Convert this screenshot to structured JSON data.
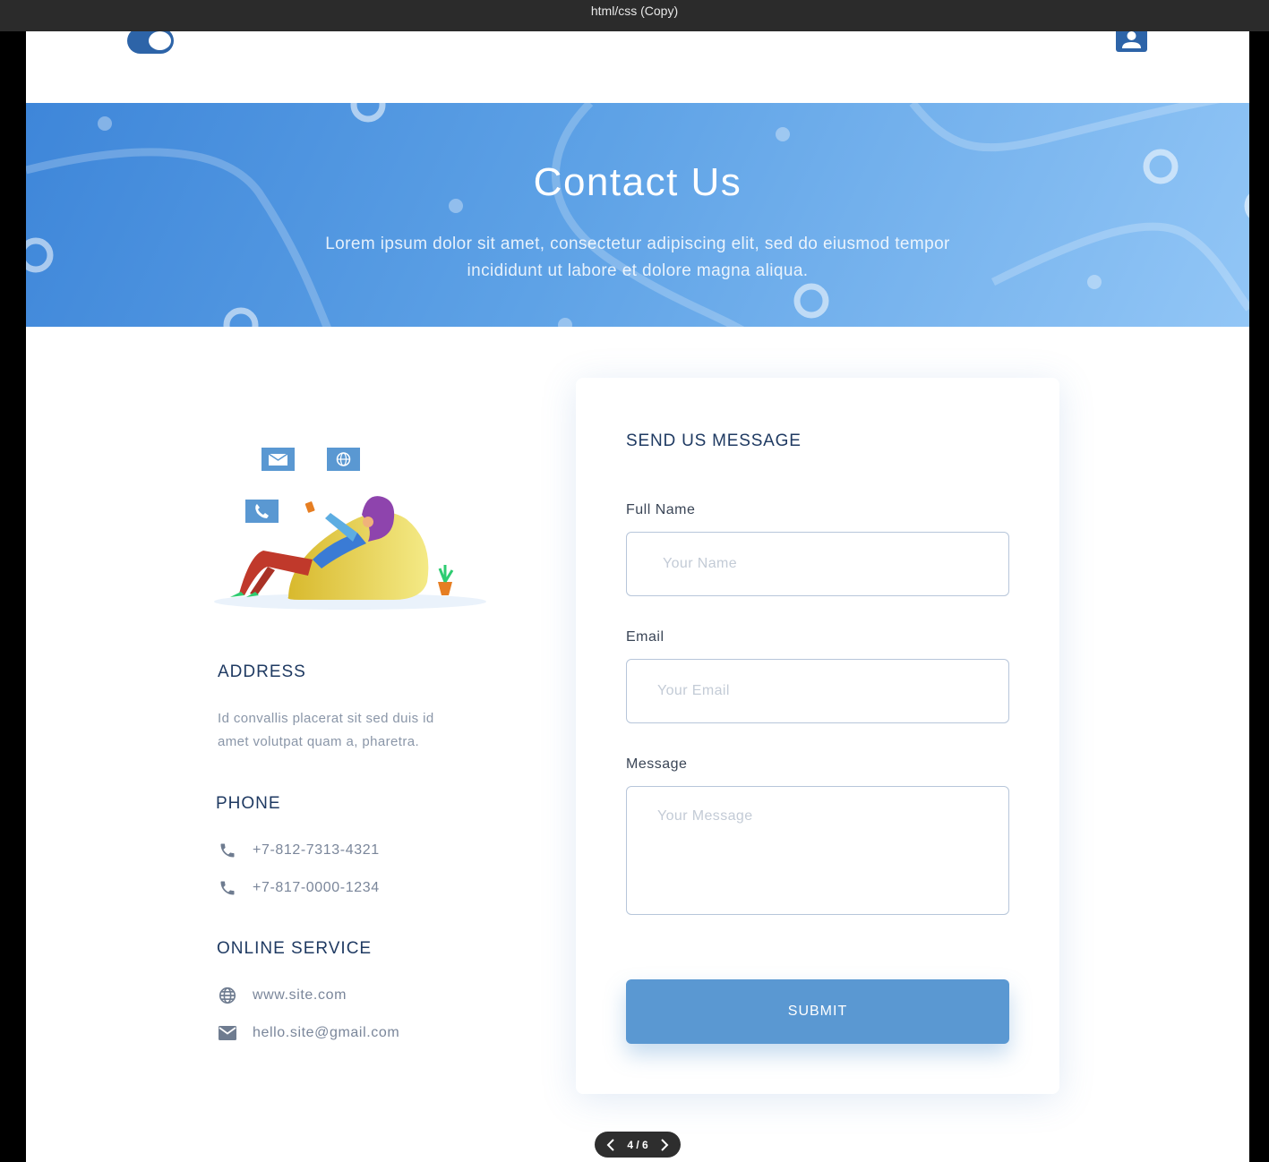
{
  "window": {
    "title": "html/css (Copy)"
  },
  "nav": {
    "toggle_icon": "toggle-icon",
    "user_icon": "user-icon"
  },
  "hero": {
    "title": "Contact Us",
    "subtitle_line1": "Lorem ipsum dolor sit amet, consectetur adipiscing elit, sed do eiusmod tempor",
    "subtitle_line2": "incididunt ut labore et dolore magna aliqua."
  },
  "info": {
    "address": {
      "heading": "ADDRESS",
      "line1": "Id convallis placerat sit sed duis id",
      "line2": "amet volutpat quam a, pharetra."
    },
    "phone": {
      "heading": "PHONE",
      "numbers": [
        "+7-812-7313-4321",
        "+7-817-0000-1234"
      ]
    },
    "online": {
      "heading": "ONLINE SERVICE",
      "website": "www.site.com",
      "email": "hello.site@gmail.com"
    }
  },
  "form": {
    "title": "SEND US MESSAGE",
    "name_label": "Full Name",
    "name_placeholder": "Your Name",
    "email_label": "Email",
    "email_placeholder": "Your Email",
    "message_label": "Message",
    "message_placeholder": "Your Message",
    "submit_label": "SUBMIT"
  },
  "pager": {
    "text": "4 / 6"
  },
  "colors": {
    "accent": "#5a98d2",
    "heading": "#1f3a62",
    "hero_start": "#3e86d9",
    "hero_end": "#92c6f6"
  }
}
